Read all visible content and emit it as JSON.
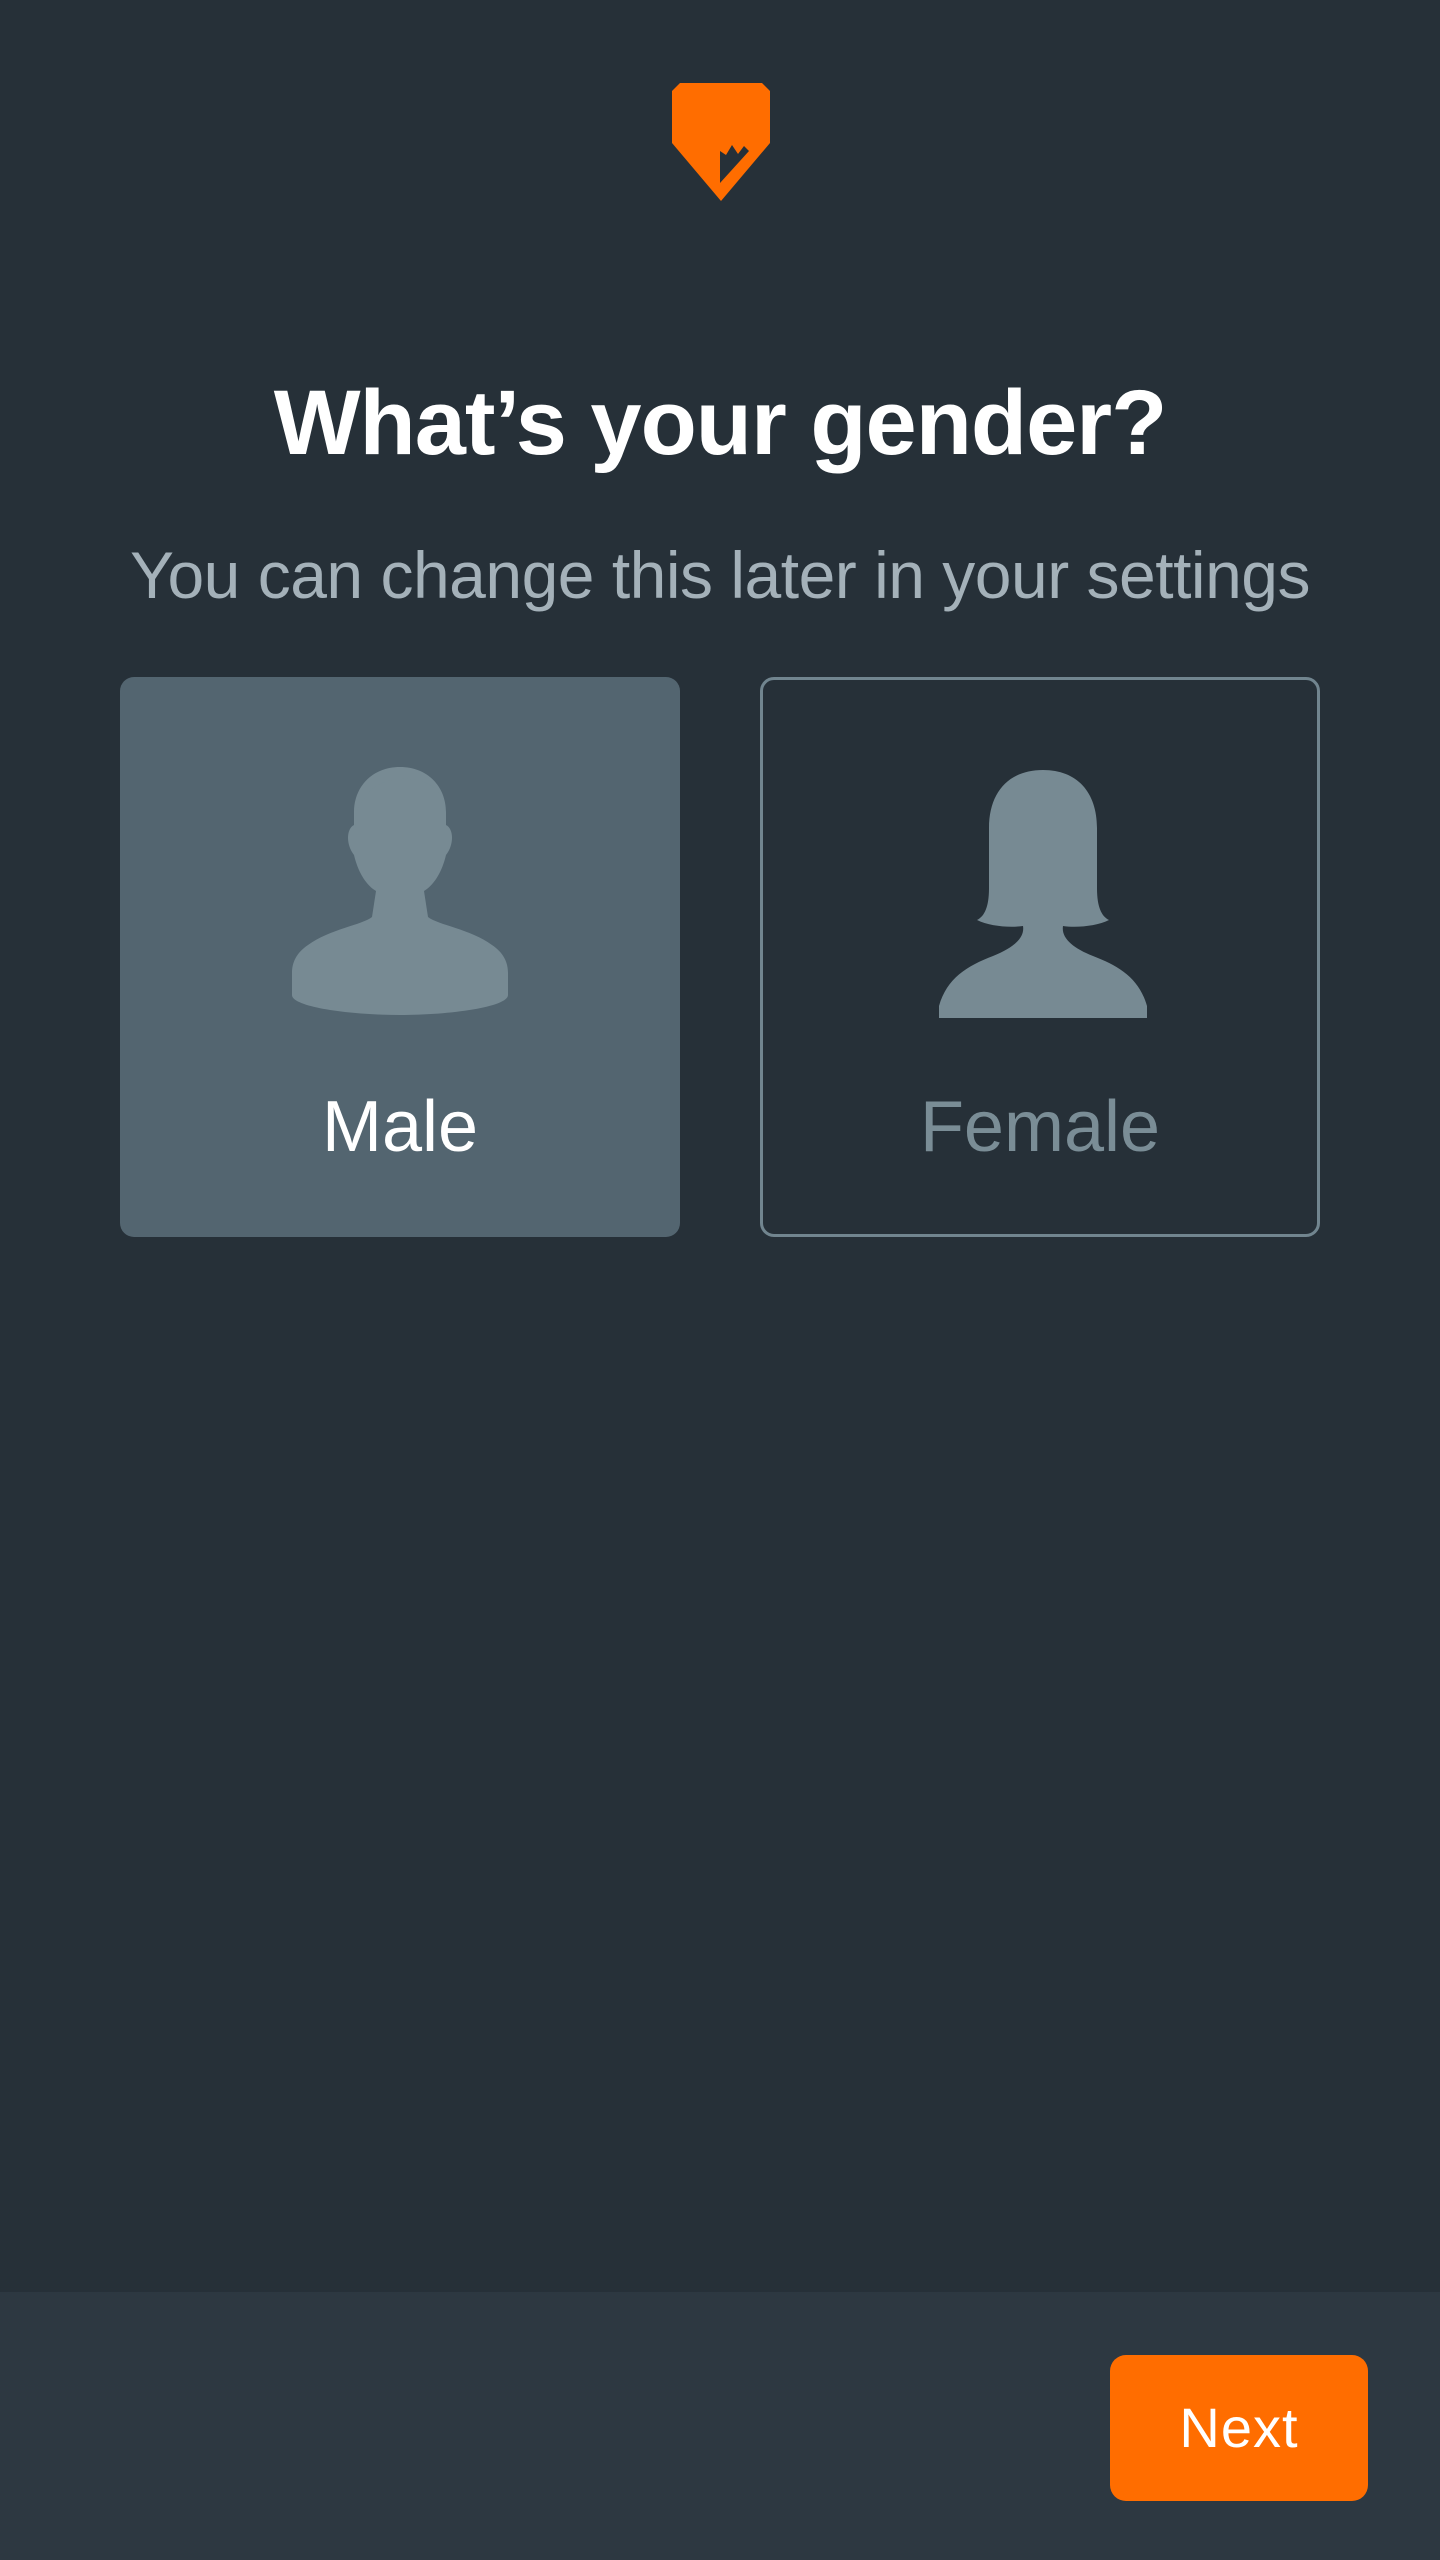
{
  "colors": {
    "background": "#263038",
    "footer": "#2d3841",
    "accent": "#ff6d00",
    "selected_card": "#536570",
    "silhouette": "#778a93"
  },
  "logo": {
    "icon": "orange-pin-logo-icon"
  },
  "header": {
    "title": "What’s your gender?",
    "subtitle": "You can change this later in your settings"
  },
  "options": [
    {
      "label": "Male",
      "icon": "male-avatar-icon",
      "selected": true
    },
    {
      "label": "Female",
      "icon": "female-avatar-icon",
      "selected": false
    }
  ],
  "footer": {
    "next_label": "Next"
  }
}
